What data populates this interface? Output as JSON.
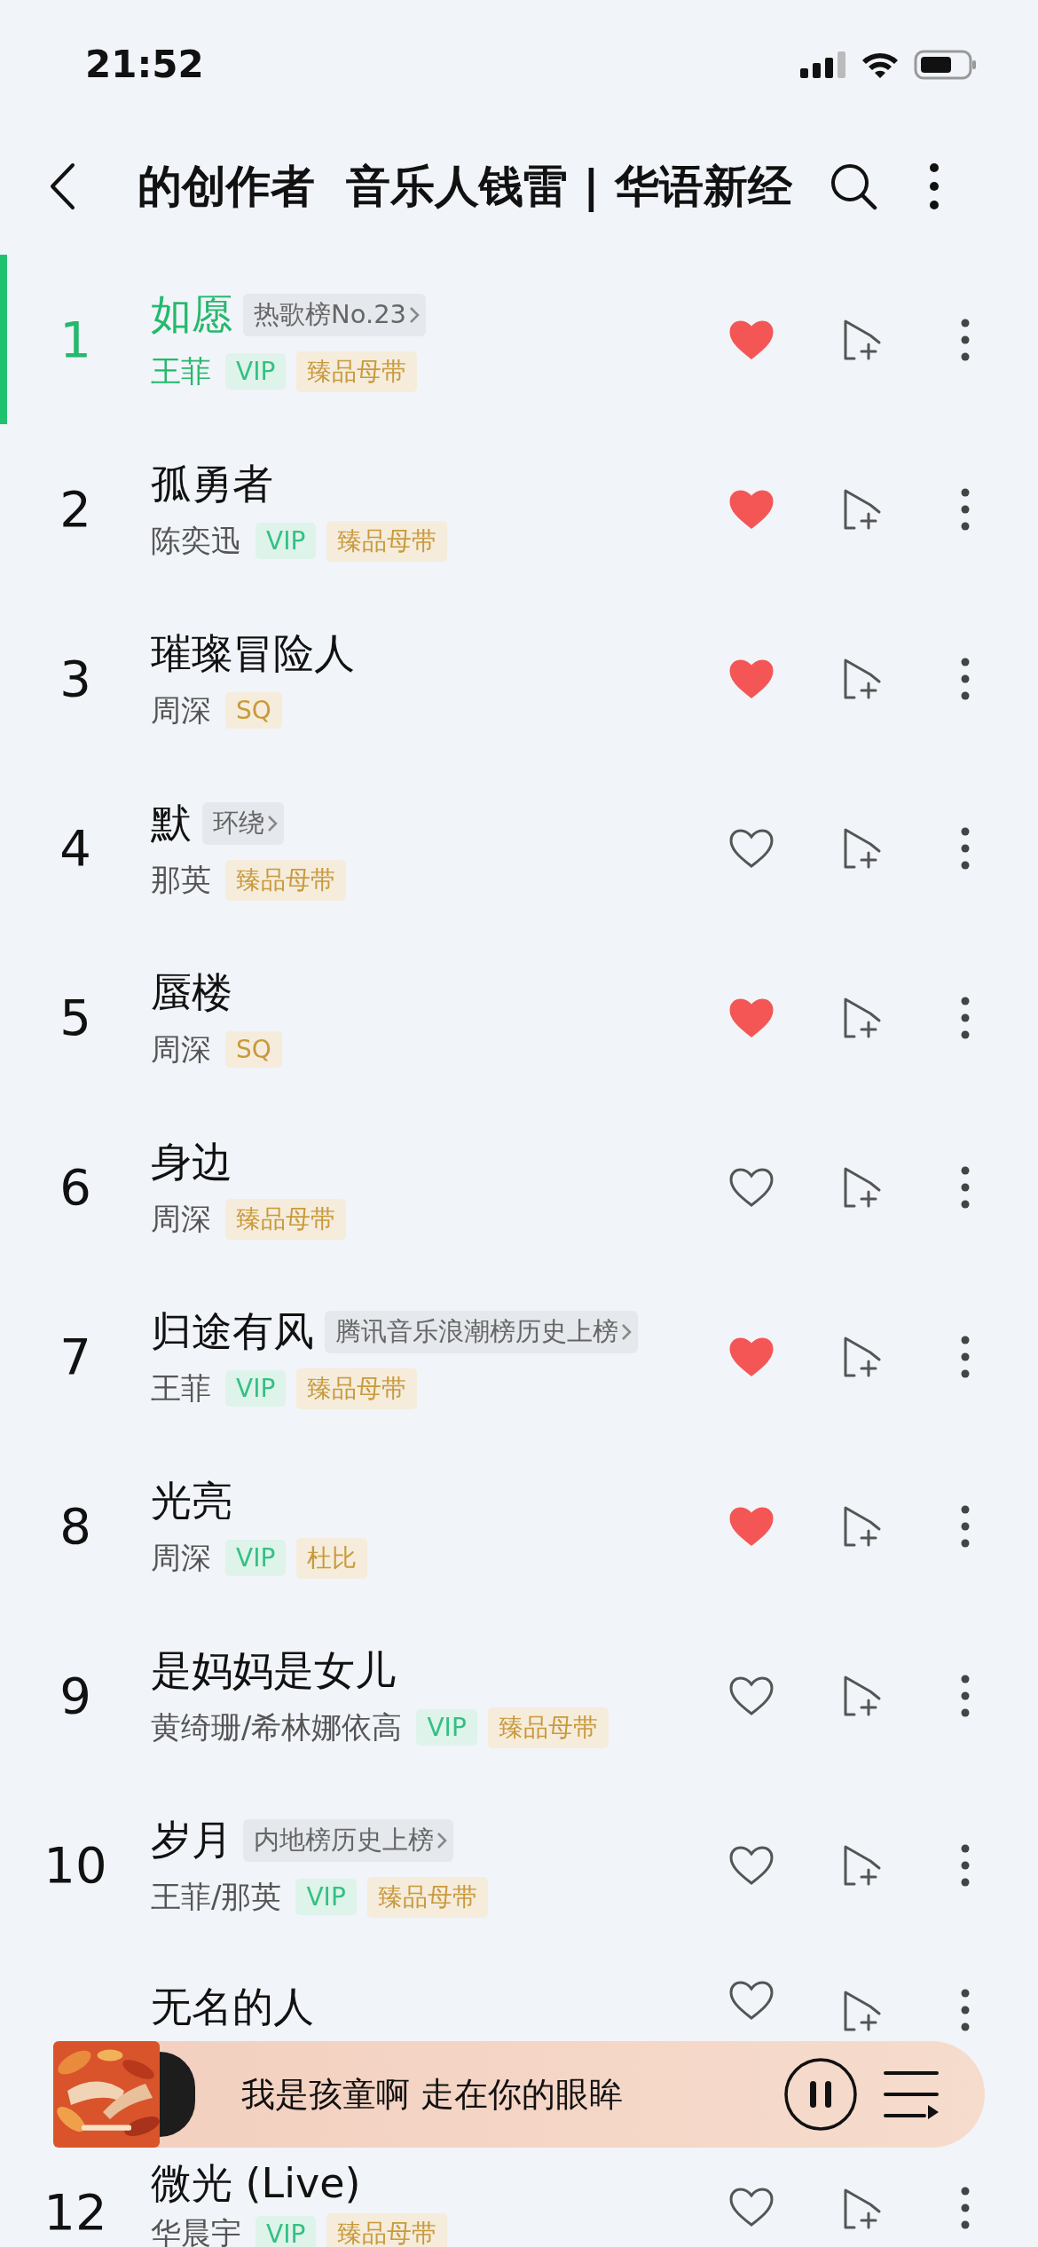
{
  "status_bar": {
    "time": "21:52"
  },
  "header": {
    "title": "的创作者  音乐人钱雷 | 华语新经"
  },
  "songs": [
    {
      "number": "1",
      "title": "如愿",
      "badge": "热歌榜No.23",
      "artists": "王菲",
      "tags": [
        {
          "kind": "vip",
          "text": "VIP"
        },
        {
          "kind": "quality",
          "text": "臻品母带"
        }
      ],
      "liked": true,
      "selected": true
    },
    {
      "number": "2",
      "title": "孤勇者",
      "artists": "陈奕迅",
      "tags": [
        {
          "kind": "vip",
          "text": "VIP"
        },
        {
          "kind": "quality",
          "text": "臻品母带"
        }
      ],
      "liked": true,
      "selected": false
    },
    {
      "number": "3",
      "title": "璀璨冒险人",
      "artists": "周深",
      "tags": [
        {
          "kind": "quality",
          "text": "SQ"
        }
      ],
      "liked": true,
      "selected": false
    },
    {
      "number": "4",
      "title": "默",
      "badge": "环绕",
      "artists": "那英",
      "tags": [
        {
          "kind": "quality",
          "text": "臻品母带"
        }
      ],
      "liked": false,
      "selected": false
    },
    {
      "number": "5",
      "title": "蜃楼",
      "artists": "周深",
      "tags": [
        {
          "kind": "quality",
          "text": "SQ"
        }
      ],
      "liked": true,
      "selected": false
    },
    {
      "number": "6",
      "title": "身边",
      "artists": "周深",
      "tags": [
        {
          "kind": "quality",
          "text": "臻品母带"
        }
      ],
      "liked": false,
      "selected": false
    },
    {
      "number": "7",
      "title": "归途有风",
      "badge": "腾讯音乐浪潮榜历史上榜",
      "artists": "王菲",
      "tags": [
        {
          "kind": "vip",
          "text": "VIP"
        },
        {
          "kind": "quality",
          "text": "臻品母带"
        }
      ],
      "liked": true,
      "selected": false
    },
    {
      "number": "8",
      "title": "光亮",
      "artists": "周深",
      "tags": [
        {
          "kind": "vip",
          "text": "VIP"
        },
        {
          "kind": "quality",
          "text": "杜比"
        }
      ],
      "liked": true,
      "selected": false
    },
    {
      "number": "9",
      "title": "是妈妈是女儿",
      "artists": "黄绮珊/希林娜依高",
      "tags": [
        {
          "kind": "vip",
          "text": "VIP"
        },
        {
          "kind": "quality",
          "text": "臻品母带"
        }
      ],
      "liked": false,
      "selected": false
    },
    {
      "number": "10",
      "title": "岁月",
      "badge": "内地榜历史上榜",
      "artists": "王菲/那英",
      "tags": [
        {
          "kind": "vip",
          "text": "VIP"
        },
        {
          "kind": "quality",
          "text": "臻品母带"
        }
      ],
      "liked": false,
      "selected": false
    },
    {
      "title": "无名的人",
      "liked": false,
      "selected": false
    },
    {
      "number": "12",
      "title": "微光 (Live)",
      "artists": "华晨宇",
      "tags": [
        {
          "kind": "vip",
          "text": "VIP"
        },
        {
          "kind": "quality",
          "text": "臻品母带"
        }
      ],
      "liked": false,
      "selected": false
    }
  ],
  "player": {
    "lyric": "我是孩童啊 走在你的眼眸",
    "playing": true
  }
}
